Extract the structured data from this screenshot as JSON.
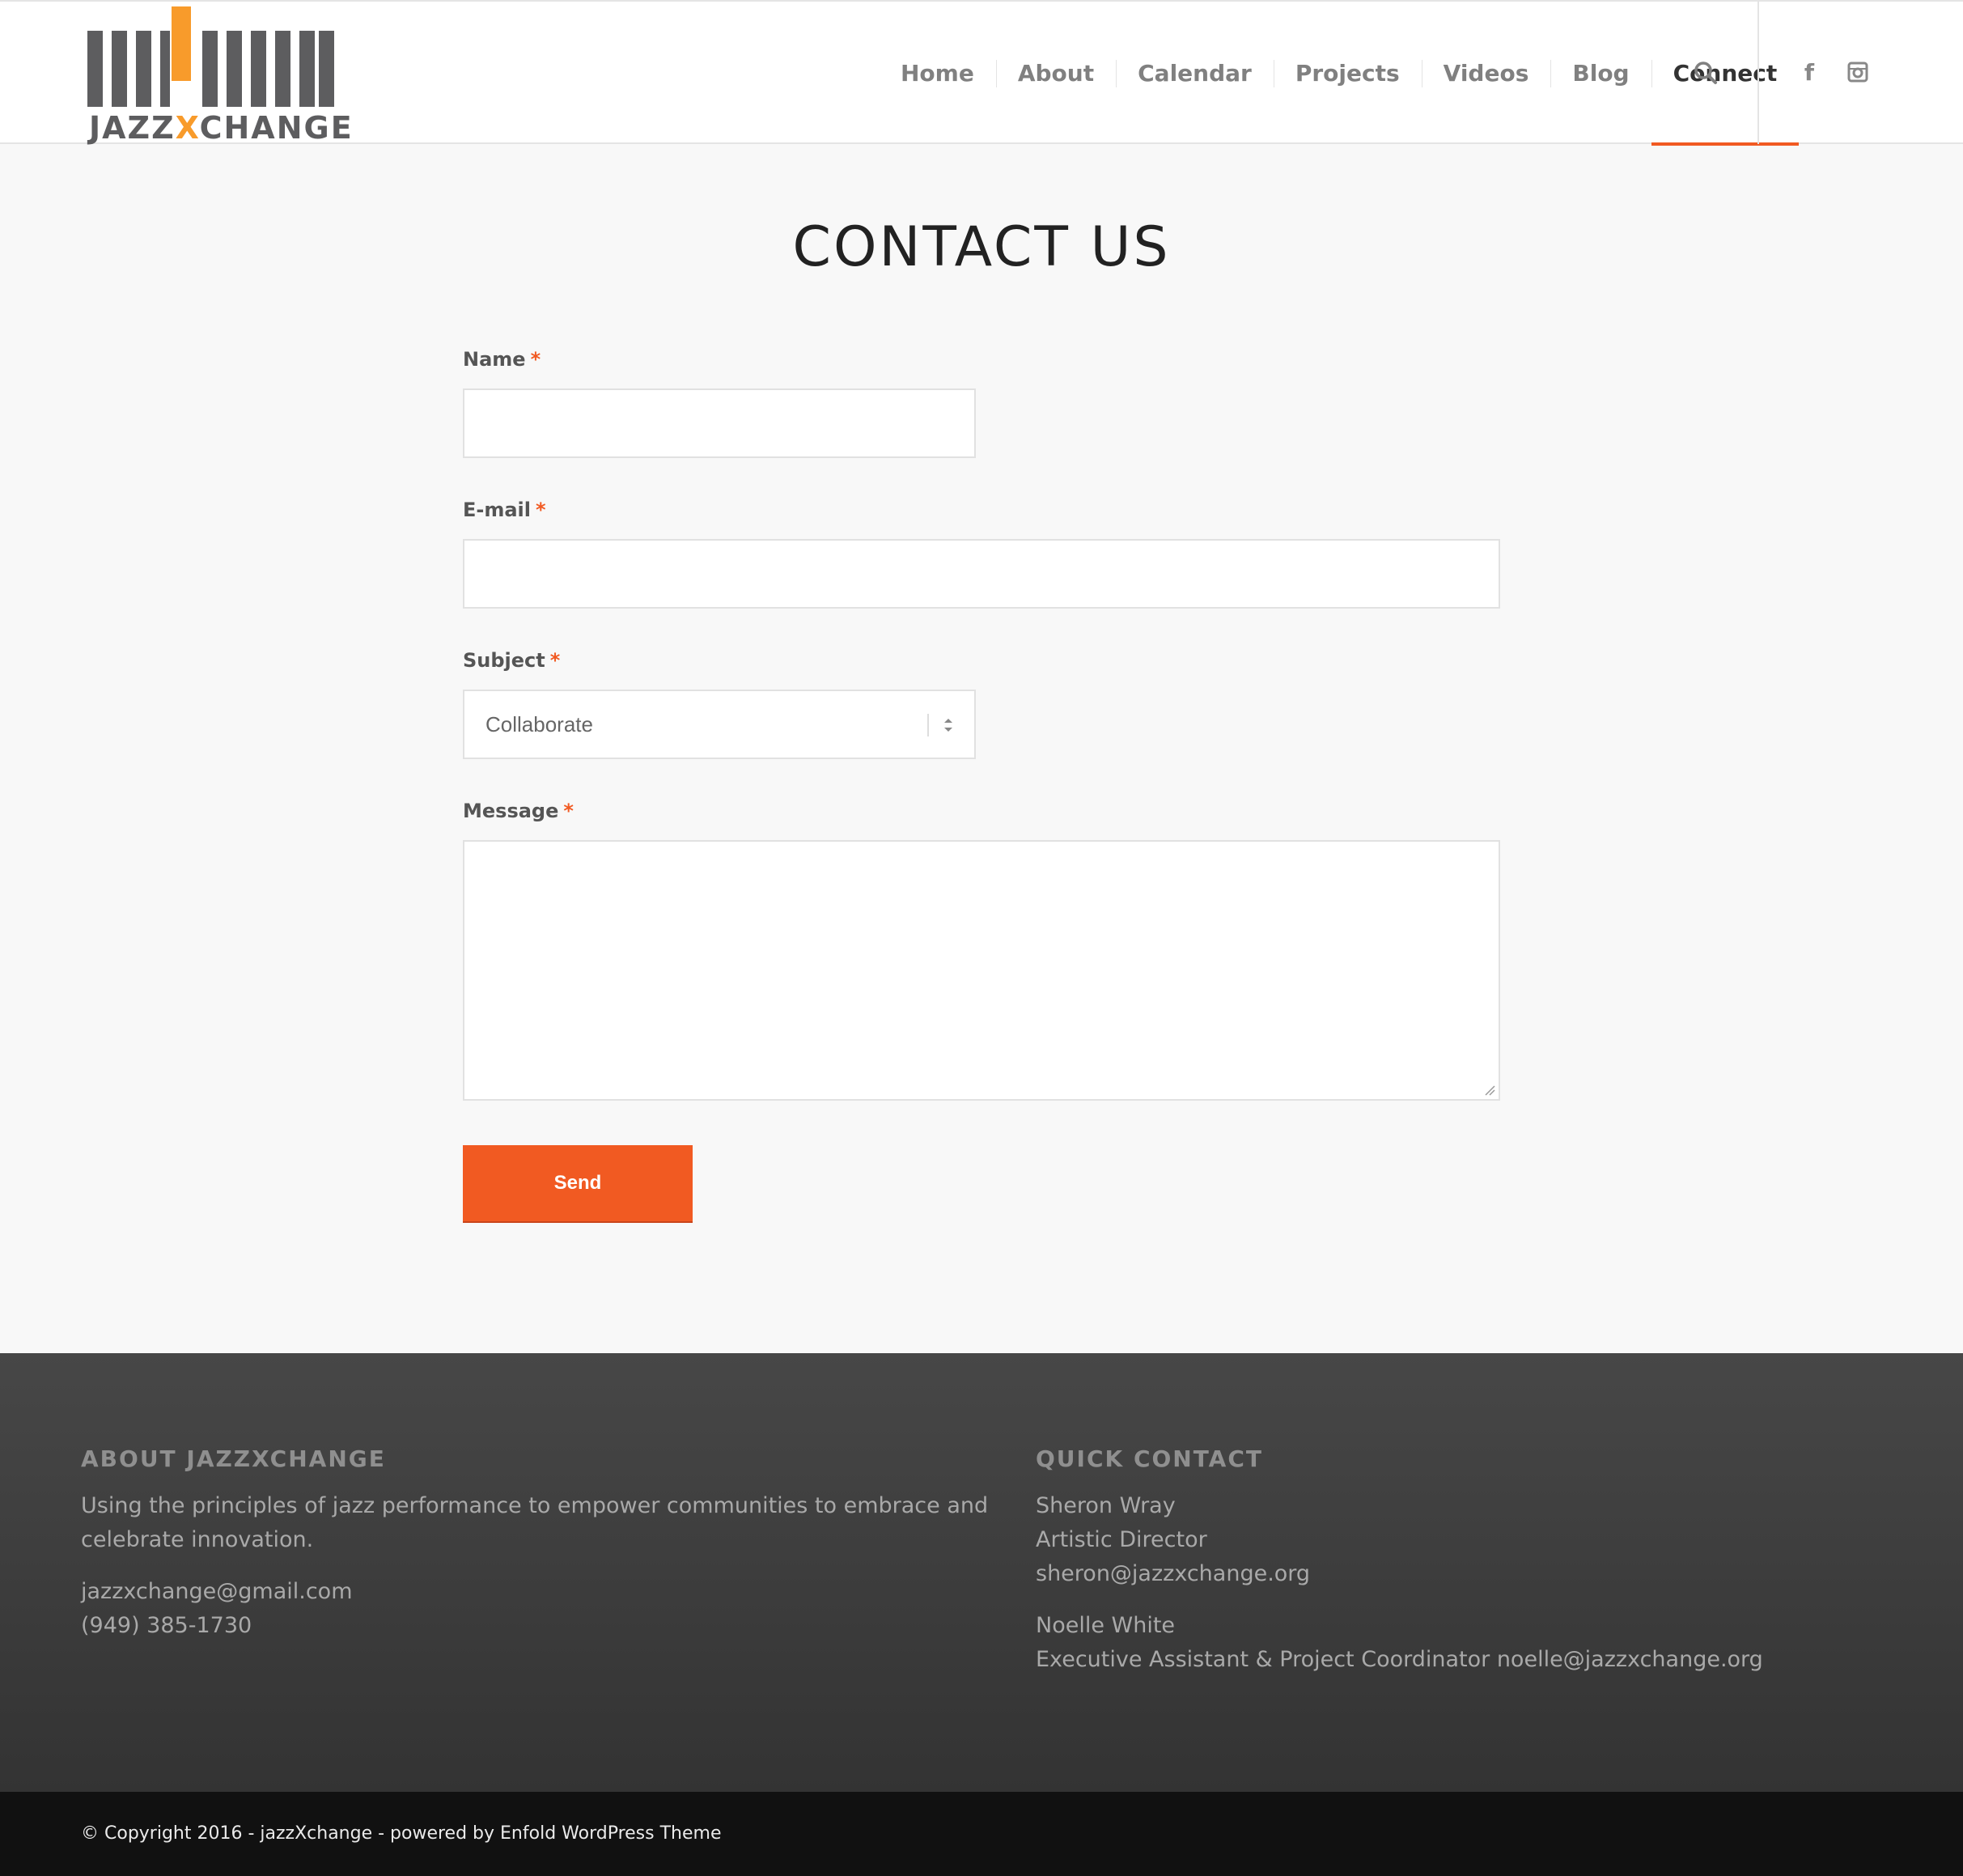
{
  "brand": {
    "logo_word_left": "JAZZ",
    "logo_word_x": "X",
    "logo_word_right": "CHANGE",
    "accent_color": "#f15a22",
    "logo_orange": "#f89b2b"
  },
  "nav": {
    "items": [
      {
        "label": "Home"
      },
      {
        "label": "About"
      },
      {
        "label": "Calendar"
      },
      {
        "label": "Projects"
      },
      {
        "label": "Videos"
      },
      {
        "label": "Blog"
      },
      {
        "label": "Connect",
        "active": true
      }
    ],
    "icons": [
      "search-icon",
      "facebook-icon",
      "instagram-icon"
    ],
    "facebook_glyph": "f"
  },
  "main": {
    "title": "CONTACT US",
    "required_mark": "*",
    "form": {
      "name_label": "Name",
      "name_value": "",
      "email_label": "E-mail",
      "email_value": "",
      "subject_label": "Subject",
      "subject_selected": "Collaborate",
      "message_label": "Message",
      "message_value": "",
      "send_label": "Send"
    }
  },
  "footer": {
    "about": {
      "heading": "ABOUT JAZZXCHANGE",
      "text_line1": "Using the principles of jazz performance to empower communities to embrace and",
      "text_line2": "celebrate innovation.",
      "email": "jazzxchange@gmail.com",
      "phone": "(949) 385-1730"
    },
    "quick_contact": {
      "heading": "QUICK CONTACT",
      "contact1_name": "Sheron Wray",
      "contact1_role": "Artistic Director",
      "contact1_email": "sheron@jazzxchange.org",
      "contact2_name": "Noelle White",
      "contact2_role_email": "Executive Assistant & Project Coordinator noelle@jazzxchange.org"
    },
    "copyright": "© Copyright 2016 - jazzXchange - powered by Enfold WordPress Theme"
  }
}
